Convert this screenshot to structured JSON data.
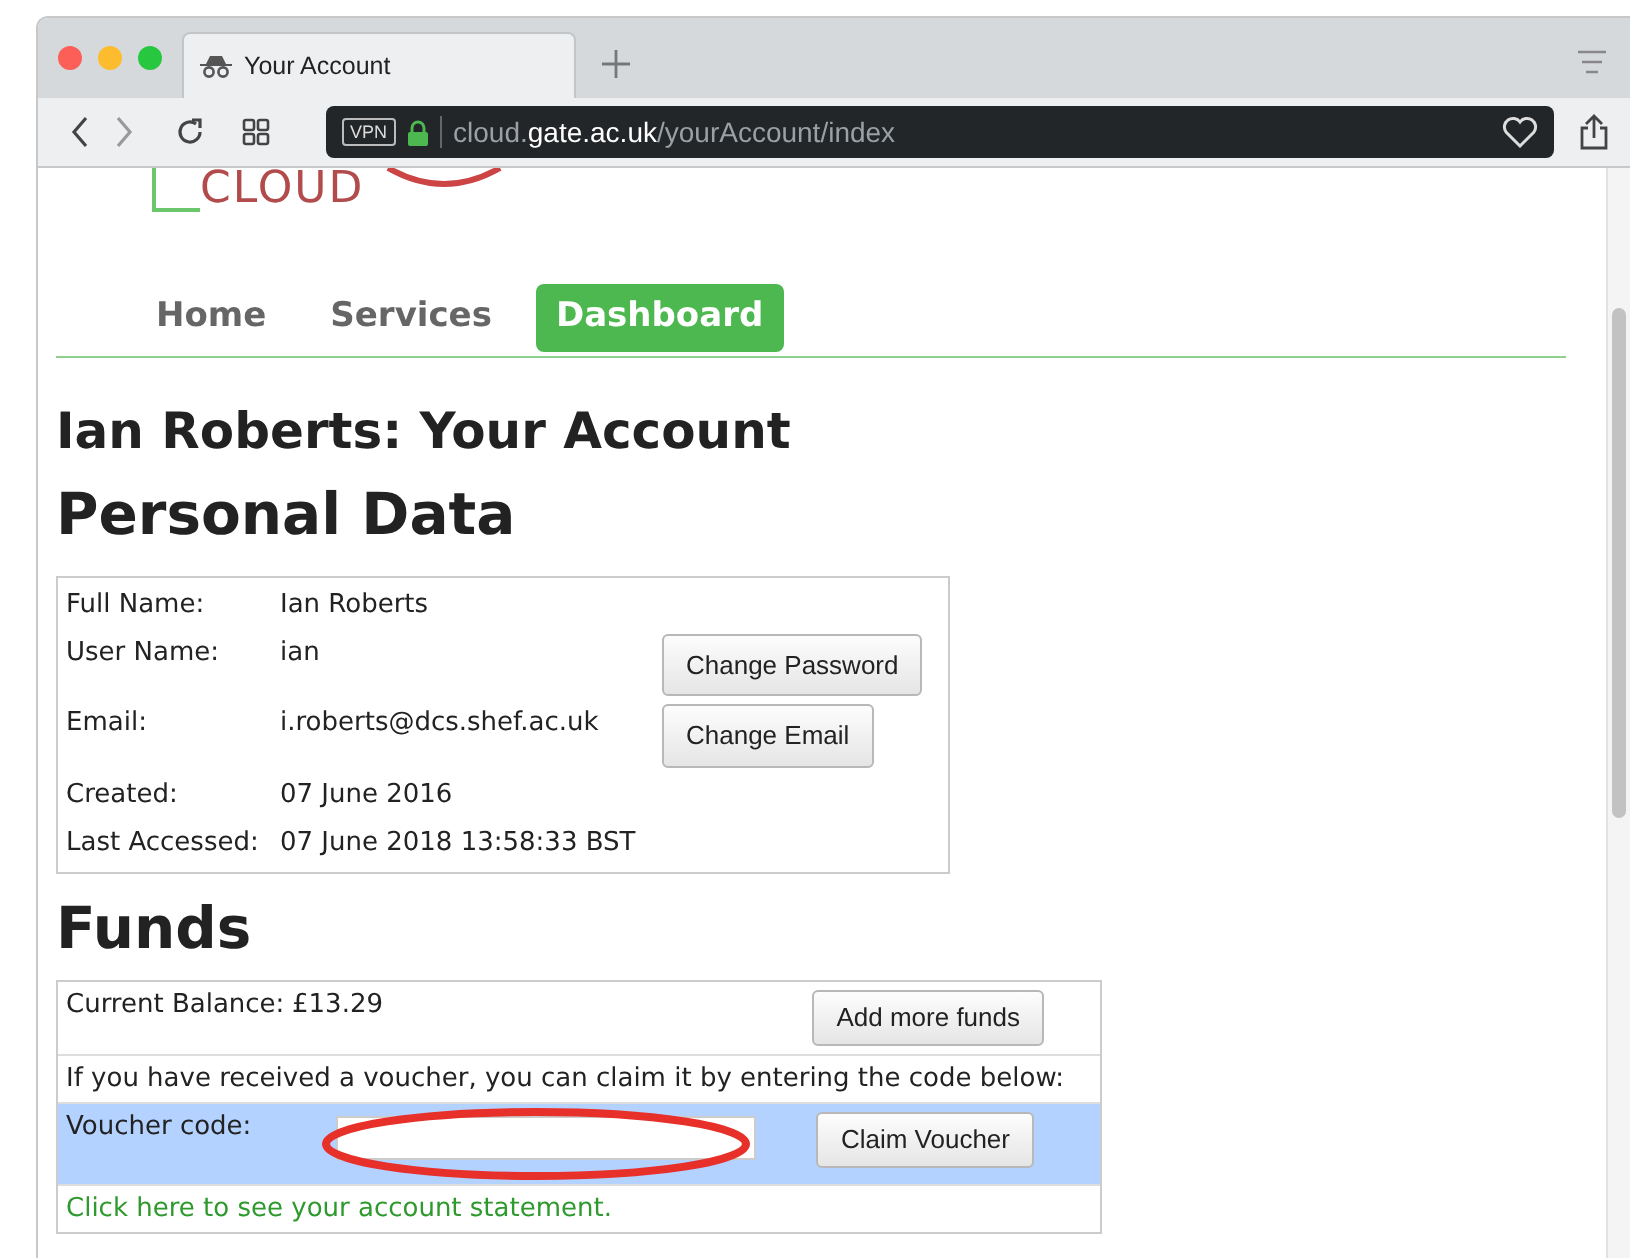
{
  "browser": {
    "tab_title": "Your Account",
    "vpn_badge": "VPN",
    "url": "cloud.**gate.ac.uk**/yourAccount/index"
  },
  "logo": {
    "text": "CLOUD"
  },
  "nav": [
    {
      "label": "Home",
      "selected": false
    },
    {
      "label": "Services",
      "selected": false
    },
    {
      "label": "Dashboard",
      "selected": true
    }
  ],
  "page_title": "Ian Roberts: Your Account",
  "personal": {
    "heading": "Personal Data",
    "rows": [
      {
        "label": "Full Name:",
        "value": "Ian Roberts"
      },
      {
        "label": "User Name:",
        "value": "ian",
        "button": "Change Password"
      },
      {
        "label": "Email:",
        "value": "i.roberts@dcs.shef.ac.uk",
        "button": "Change Email"
      },
      {
        "label": "Created:",
        "value": "07 June 2016"
      },
      {
        "label": "Last Accessed:",
        "value": "07 June 2018 13:58:33 BST"
      }
    ]
  },
  "funds": {
    "heading": "Funds",
    "balance_label": "Current Balance:",
    "balance": "£13.29",
    "add_button": "Add more funds",
    "voucher_prompt": "If you have received a voucher, you can claim it by entering the code below:",
    "voucher_label": "Voucher code:",
    "claim_button": "Claim Voucher",
    "statement_link": "Click here to see your account statement."
  }
}
